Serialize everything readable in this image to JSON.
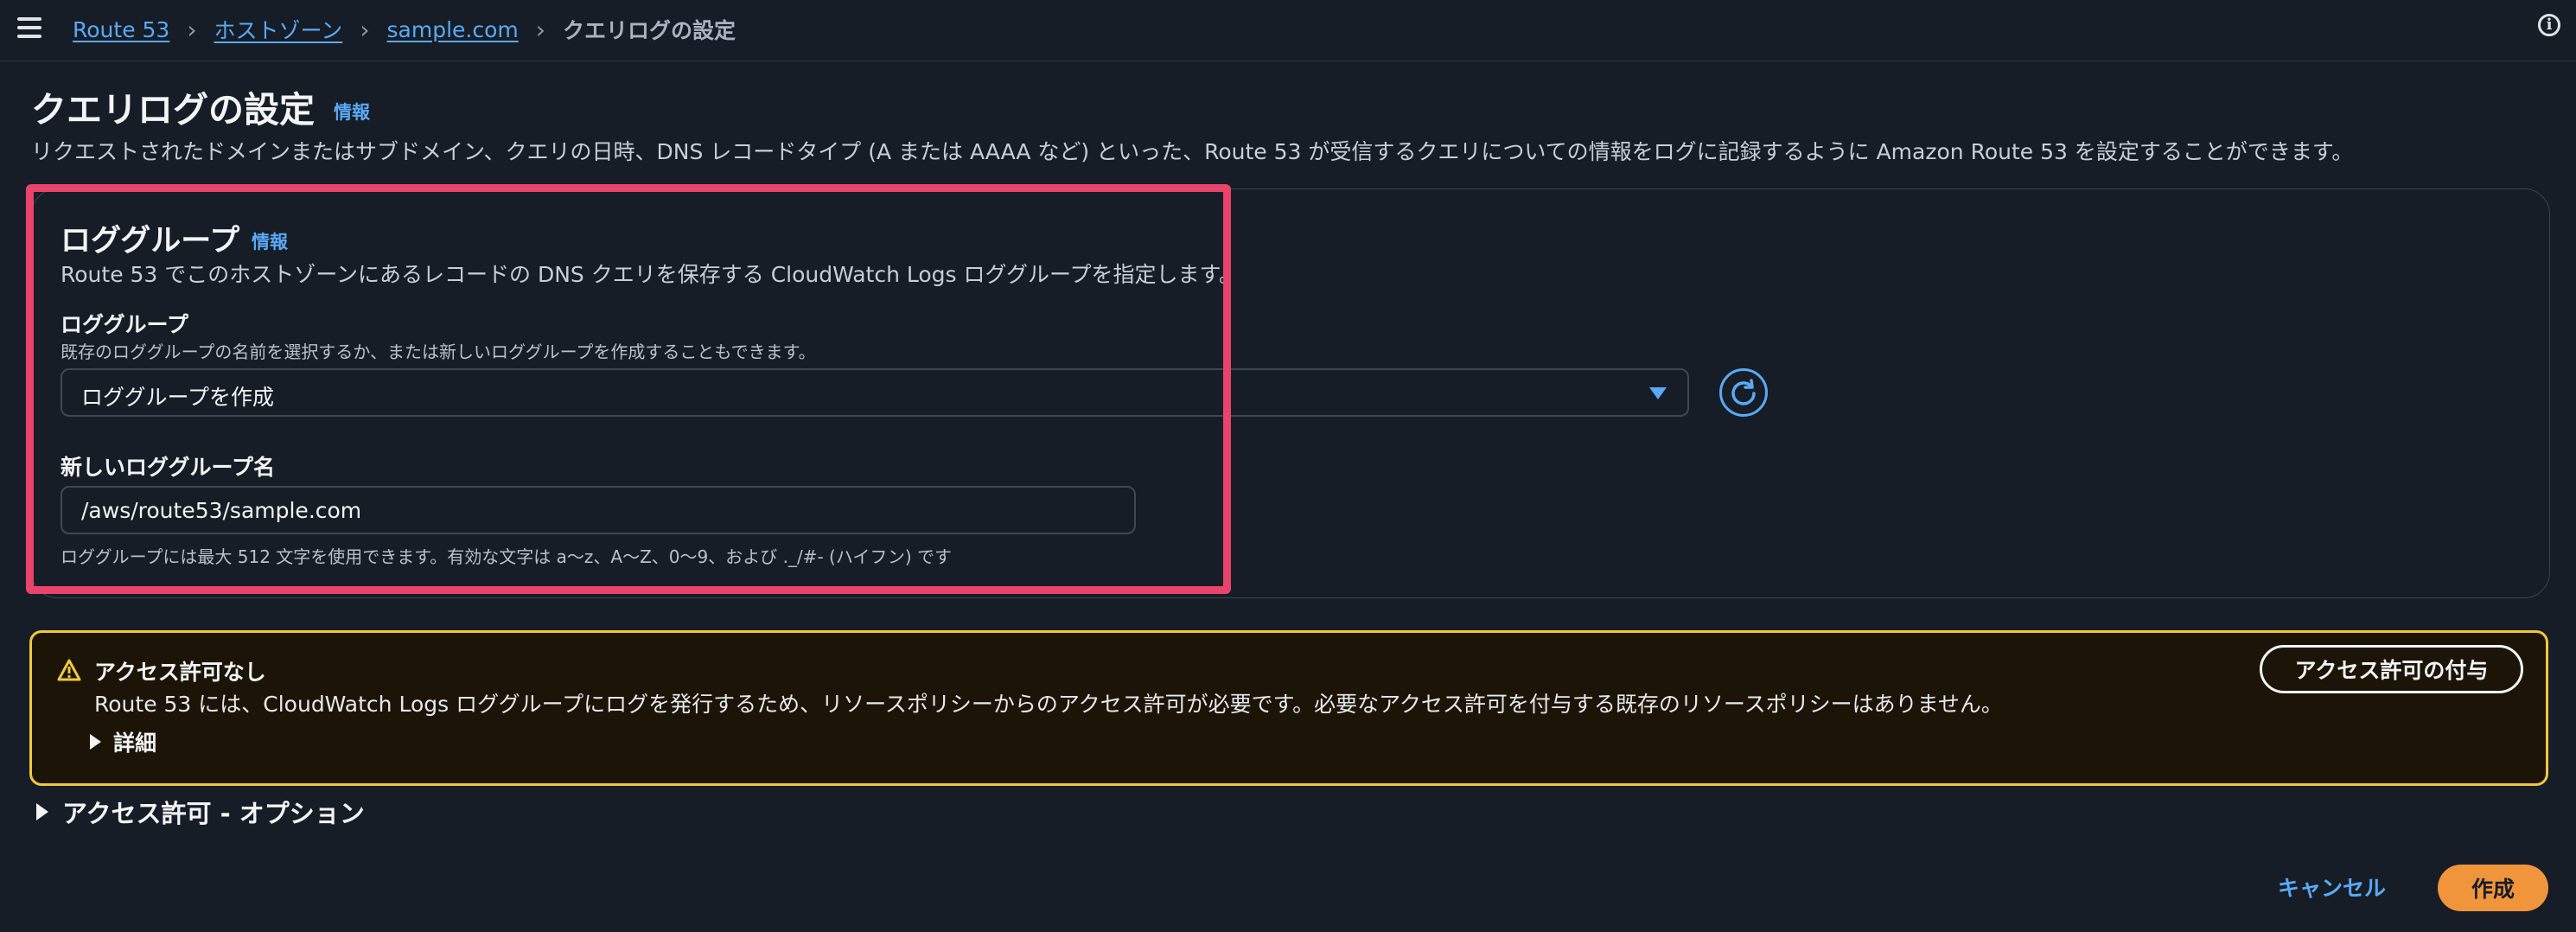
{
  "breadcrumb": {
    "items": [
      "Route 53",
      "ホストゾーン",
      "sample.com"
    ],
    "current": "クエリログの設定"
  },
  "header": {
    "title": "クエリログの設定",
    "info": "情報",
    "description": "リクエストされたドメインまたはサブドメイン、クエリの日時、DNS レコードタイプ (A または AAAA など) といった、Route 53 が受信するクエリについての情報をログに記録するように Amazon Route 53 を設定することができます。"
  },
  "log_group_section": {
    "title": "ロググループ",
    "info": "情報",
    "description": "Route 53 でこのホストゾーンにあるレコードの DNS クエリを保存する CloudWatch Logs ロググループを指定します。",
    "select_label": "ロググループ",
    "select_hint": "既存のロググループの名前を選択するか、または新しいロググループを作成することもできます。",
    "select_value": "ロググループを作成",
    "new_name_label": "新しいロググループ名",
    "new_name_value": "/aws/route53/sample.com",
    "new_name_hint": "ロググループには最大 512 文字を使用できます。有効な文字は a～z、A～Z、0～9、および ._/#- (ハイフン) です"
  },
  "alert": {
    "title": "アクセス許可なし",
    "body": "Route 53 には、CloudWatch Logs ロググループにログを発行するため、リソースポリシーからのアクセス許可が必要です。必要なアクセス許可を付与する既存のリソースポリシーはありません。",
    "details": "詳細",
    "button": "アクセス許可の付与"
  },
  "permissions_toggle": "アクセス許可 - オプション",
  "footer": {
    "cancel": "キャンセル",
    "create": "作成"
  },
  "colors": {
    "background": "#161d26",
    "link": "#5aa9f5",
    "highlight": "#e8446c",
    "warning_border": "#f0c83c",
    "primary_button": "#f1953c"
  }
}
